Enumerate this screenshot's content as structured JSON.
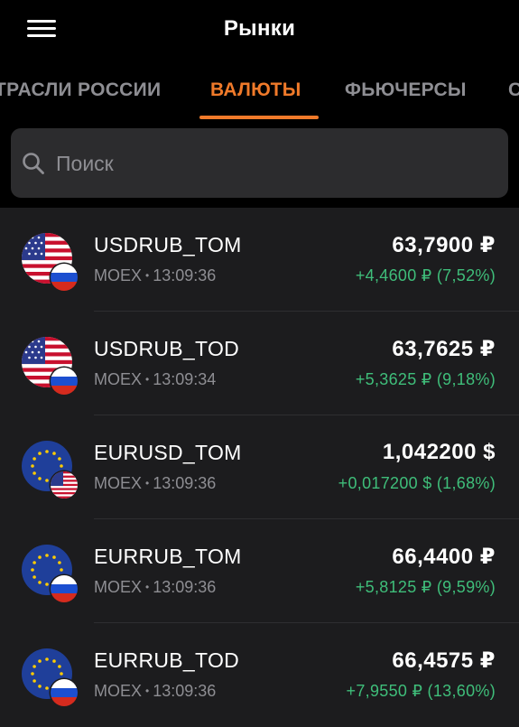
{
  "header": {
    "title": "Рынки"
  },
  "tabs": [
    {
      "label": "ТРАСЛИ РОССИИ"
    },
    {
      "label": "ВАЛЮТЫ",
      "active": true
    },
    {
      "label": "ФЬЮЧЕРСЫ"
    },
    {
      "label": "С"
    }
  ],
  "colors": {
    "accent": "#f07a2a",
    "positive": "#3fbe7a",
    "muted": "#8e8e93"
  },
  "search": {
    "placeholder": "Поиск",
    "value": ""
  },
  "rows": [
    {
      "name": "USDRUB_TOM",
      "exchange": "MOEX",
      "time": "13:09:36",
      "price": "63,7900 ₽",
      "change": "+4,4600 ₽ (7,52%)",
      "flag": "us-flag-icon",
      "badge": "ru-flag-icon"
    },
    {
      "name": "USDRUB_TOD",
      "exchange": "MOEX",
      "time": "13:09:34",
      "price": "63,7625 ₽",
      "change": "+5,3625 ₽ (9,18%)",
      "flag": "us-flag-icon",
      "badge": "ru-flag-icon"
    },
    {
      "name": "EURUSD_TOM",
      "exchange": "MOEX",
      "time": "13:09:36",
      "price": "1,042200 $",
      "change": "+0,017200 $ (1,68%)",
      "flag": "eu-flag-icon",
      "badge": "us-flag-icon"
    },
    {
      "name": "EURRUB_TOM",
      "exchange": "MOEX",
      "time": "13:09:36",
      "price": "66,4400 ₽",
      "change": "+5,8125 ₽ (9,59%)",
      "flag": "eu-flag-icon",
      "badge": "ru-flag-icon"
    },
    {
      "name": "EURRUB_TOD",
      "exchange": "MOEX",
      "time": "13:09:36",
      "price": "66,4575 ₽",
      "change": "+7,9550 ₽ (13,60%)",
      "flag": "eu-flag-icon",
      "badge": "ru-flag-icon"
    }
  ]
}
